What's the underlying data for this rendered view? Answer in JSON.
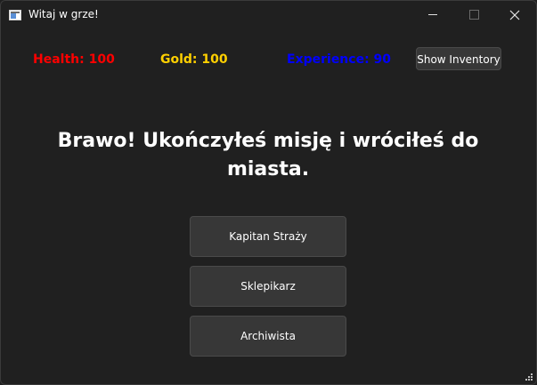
{
  "window": {
    "title": "Witaj w grze!"
  },
  "stats": {
    "health": "Health: 100",
    "gold": "Gold: 100",
    "experience": "Experience: 90",
    "colors": {
      "health": "#ff0000",
      "gold": "#ffd000",
      "experience": "#0000ff"
    }
  },
  "toolbar": {
    "inventory_label": "Show Inventory"
  },
  "main": {
    "message": "Brawo! Ukończyłeś misję i wróciłeś do miasta."
  },
  "npcs": [
    {
      "label": "Kapitan Straży"
    },
    {
      "label": "Sklepikarz"
    },
    {
      "label": "Archiwista"
    }
  ],
  "icons": {
    "app": "app-window-icon",
    "minimize": "minimize-icon",
    "maximize": "maximize-icon",
    "close": "close-icon",
    "resize": "resize-grip-icon"
  }
}
